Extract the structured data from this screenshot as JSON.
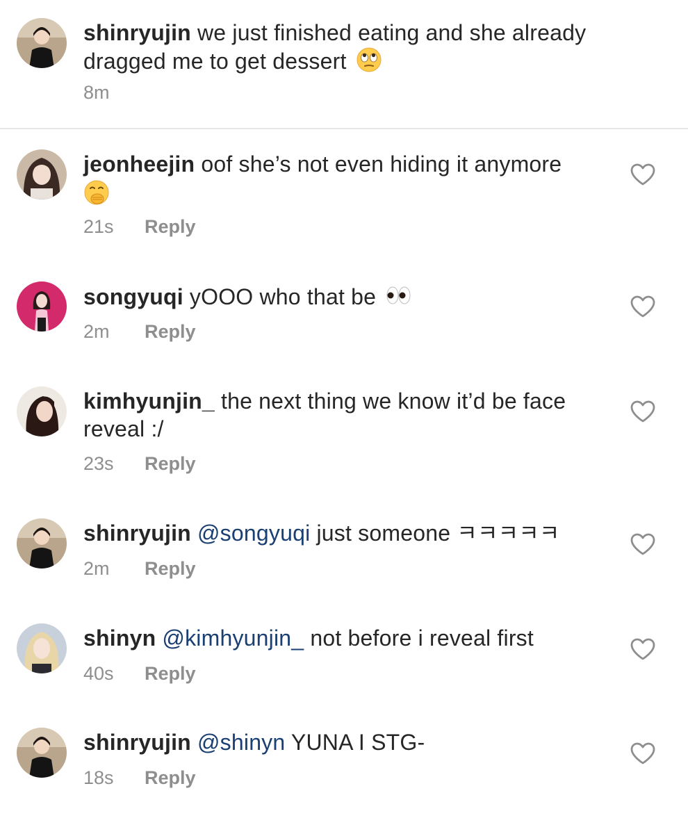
{
  "caption": {
    "username": "shinryujin",
    "text": "we just finished eating and she already dragged me to get dessert",
    "emoji": "face-with-rolling-eyes",
    "time": "8m"
  },
  "comments": [
    {
      "username": "jeonheejin",
      "mention": "",
      "text": "oof she’s not even hiding it anymore",
      "emoji": "face-with-hand-over-mouth",
      "time": "21s",
      "reply_label": "Reply"
    },
    {
      "username": "songyuqi",
      "mention": "",
      "text": "yOOO who that be",
      "emoji": "eyes",
      "time": "2m",
      "reply_label": "Reply"
    },
    {
      "username": "kimhyunjin_",
      "mention": "",
      "text": "the next thing we know it’d be face reveal :/",
      "emoji": "",
      "time": "23s",
      "reply_label": "Reply"
    },
    {
      "username": "shinryujin",
      "mention": "@songyuqi",
      "text": "just someone ㅋㅋㅋㅋㅋ",
      "emoji": "",
      "time": "2m",
      "reply_label": "Reply"
    },
    {
      "username": "shinyn",
      "mention": "@kimhyunjin_",
      "text": "not before i reveal first",
      "emoji": "",
      "time": "40s",
      "reply_label": "Reply"
    },
    {
      "username": "shinryujin",
      "mention": "@shinyn",
      "text": "YUNA I STG-",
      "emoji": "",
      "time": "18s",
      "reply_label": "Reply"
    }
  ],
  "colors": {
    "text": "#262626",
    "secondary": "#8e8e8e",
    "mention": "#1a3f72",
    "divider": "#e6e6e6"
  }
}
